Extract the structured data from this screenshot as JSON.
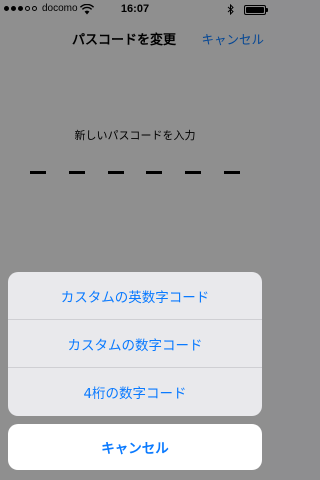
{
  "status_bar": {
    "carrier": "docomo",
    "time": "16:07"
  },
  "nav": {
    "title": "パスコードを変更",
    "cancel_label": "キャンセル"
  },
  "passcode": {
    "prompt": "新しいパスコードを入力",
    "digit_count": 6
  },
  "action_sheet": {
    "options": [
      {
        "label": "カスタムの英数字コード"
      },
      {
        "label": "カスタムの数字コード"
      },
      {
        "label": "4桁の数字コード"
      }
    ],
    "cancel_label": "キャンセル"
  },
  "colors": {
    "accent": "#0a7aff"
  }
}
